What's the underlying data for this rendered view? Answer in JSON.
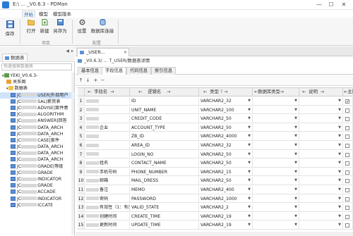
{
  "window": {
    "title": "E:\\ ... _V0.6.3 - PDMan",
    "minimize": "—",
    "maximize": "☐",
    "close": "✕"
  },
  "ribbon": {
    "tabs": [
      "开始",
      "模型",
      "模型版本"
    ],
    "buttons": {
      "save": "保存",
      "open": "打开",
      "new": "新建",
      "save_as": "另存为",
      "settings": "设置",
      "db_connect": "数据库连接"
    },
    "groups": {
      "project": "项目",
      "config": "配置"
    }
  },
  "left_panel": {
    "tab": "数据表",
    "search_placeholder": "快速搜索数据表",
    "root": "YEKI_V0.6.3-",
    "relation": "关系图",
    "tables_folder": "数据表",
    "items": [
      "USER|外部用户",
      "SAL|薪资表",
      "ADVISE|案件意",
      "ALGORITHM",
      "ANSWER|回答",
      "DATA_ARCH",
      "DATA_ARCH",
      "CASE|案件",
      "DATA_ARCH",
      "DATA_ARCH",
      "DATA_ARCH",
      "GRADE|等级",
      "GRADE",
      "INDICATOR",
      "GRADE",
      "ACCADE",
      "INDICATOR",
      "ICCATE"
    ]
  },
  "doc_tab": "_USER...",
  "breadcrumb": "_V0.6.3/ ... T_USER/数据表详情",
  "inner_tabs": [
    "基本信息",
    "字段信息",
    "代码信息",
    "索引信息"
  ],
  "toolbar": {
    "up": "↑",
    "down": "↓",
    "add": "+",
    "remove": "−"
  },
  "grid": {
    "headers": {
      "field_name": "字段名",
      "logic_name": "逻辑名",
      "type": "类型",
      "db_type": "数据库类型",
      "remark": "说明",
      "primary": "主键"
    },
    "rows": [
      {
        "num": "1",
        "name": "",
        "logic": "ID",
        "type": "VARCHAR2_32",
        "pk": true
      },
      {
        "num": "2",
        "name": "",
        "logic": "UNIT_NAME",
        "type": "VARCHAR2_100",
        "pk": false
      },
      {
        "num": "3",
        "name": "",
        "logic": "CREDIT_CODE",
        "type": "VARCHAR2_50",
        "pk": false
      },
      {
        "num": "4",
        "name": "企业",
        "logic": "ACCOUNT_TYPE",
        "type": "VARCHAR2_50",
        "pk": false
      },
      {
        "num": "5",
        "name": "",
        "logic": "ZB_ID",
        "type": "VARCHAR2_4000",
        "pk": false
      },
      {
        "num": "6",
        "name": "",
        "logic": "AREA_ID",
        "type": "VARCHAR2_32",
        "pk": false
      },
      {
        "num": "7",
        "name": "",
        "logic": "LOGIN_NO",
        "type": "VARCHAR2_50",
        "pk": false
      },
      {
        "num": "8",
        "name": "姓名",
        "logic": "CONTACT_NAME",
        "type": "VARCHAR2_50",
        "pk": false
      },
      {
        "num": "9",
        "name": "手机号码",
        "logic": "PHONE_NUMBER",
        "type": "VARCHAR2_15",
        "pk": false
      },
      {
        "num": "10",
        "name": "邮箱",
        "logic": "MAIL_DRESS",
        "type": "VARCHAR2_50",
        "pk": false
      },
      {
        "num": "11",
        "name": "备注",
        "logic": "MEMO",
        "type": "VARCHAR2_400",
        "pk": false
      },
      {
        "num": "12",
        "name": "密码",
        "logic": "PASSWORD",
        "type": "VARCHAR2_1000",
        "pk": false
      },
      {
        "num": "13",
        "name": "有效性（1：有效）",
        "logic": "VALID_STATE",
        "type": "VARCHAR2_2",
        "pk": false
      },
      {
        "num": "14",
        "name": "创建时间",
        "logic": "CREATE_TIME",
        "type": "VARCHAR2_19",
        "pk": false
      },
      {
        "num": "15",
        "name": "更新时间",
        "logic": "UPDATE_TIME",
        "type": "VARCHAR2_19",
        "pk": false
      }
    ]
  }
}
